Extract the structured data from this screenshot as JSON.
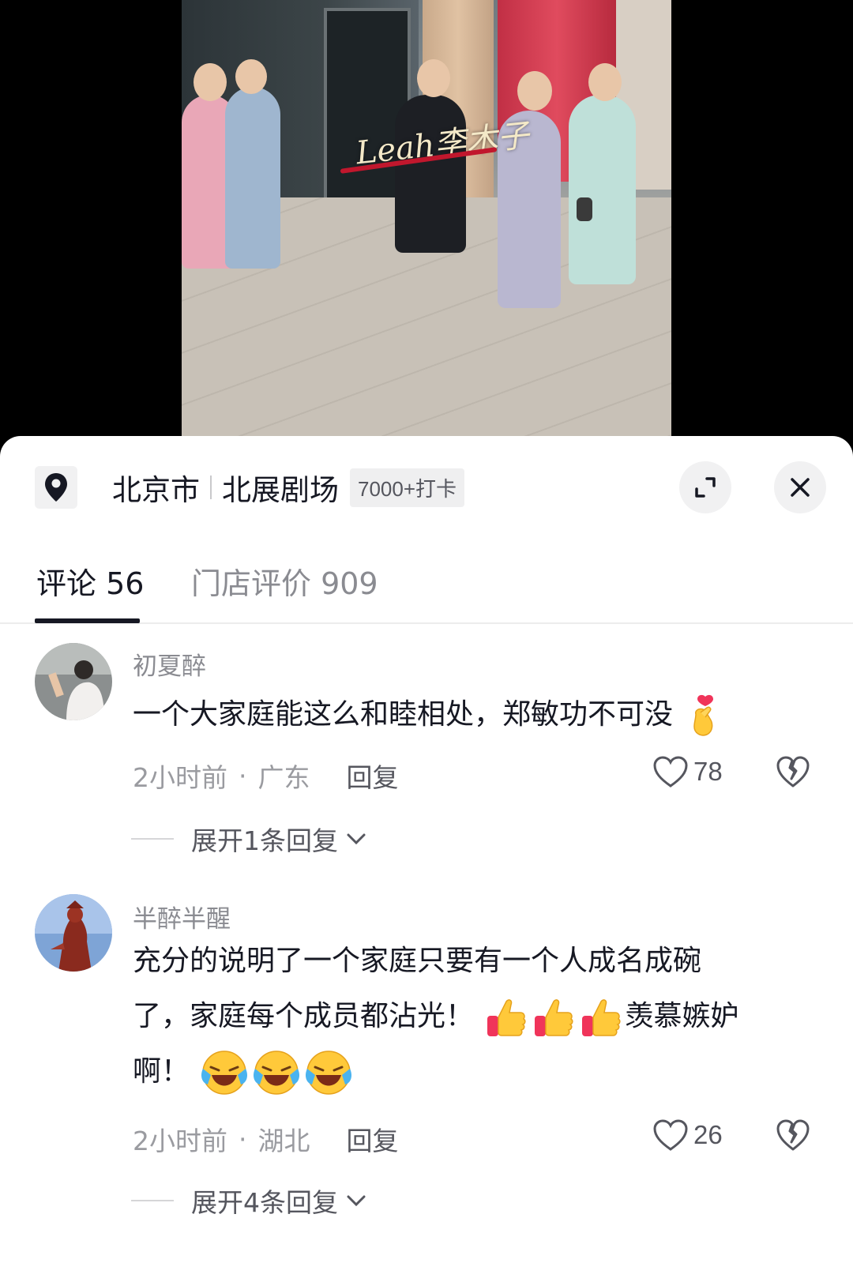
{
  "location": {
    "city": "北京市",
    "venue": "北展剧场",
    "checkins": "7000+打卡"
  },
  "tabs": {
    "comments": "评论 56",
    "reviews": "门店评价 909"
  },
  "comments": [
    {
      "username": "初夏醉",
      "text": "一个大家庭能这么和睦相处，郑敏功不可没",
      "emoji_after": "finger-heart-emoji",
      "time": "2小时前",
      "region": "广东",
      "reply_label": "回复",
      "likes": "78",
      "expand_label": "展开1条回复"
    },
    {
      "username": "半醉半醒",
      "text_line1": "充分的说明了一个家庭只要有一个人成名成碗",
      "text_line2_a": "了，家庭每个成员都沾光！",
      "text_line2_b": "羡慕嫉妒",
      "text_line3": "啊！",
      "time": "2小时前",
      "region": "湖北",
      "reply_label": "回复",
      "likes": "26",
      "expand_label": "展开4条回复"
    }
  ],
  "meta_separator": "·",
  "video": {
    "watermark": "Leah李木子"
  },
  "colors": {
    "primary_text": "#161823",
    "secondary_text": "#8a8b91",
    "sheet_bg": "#ffffff"
  }
}
